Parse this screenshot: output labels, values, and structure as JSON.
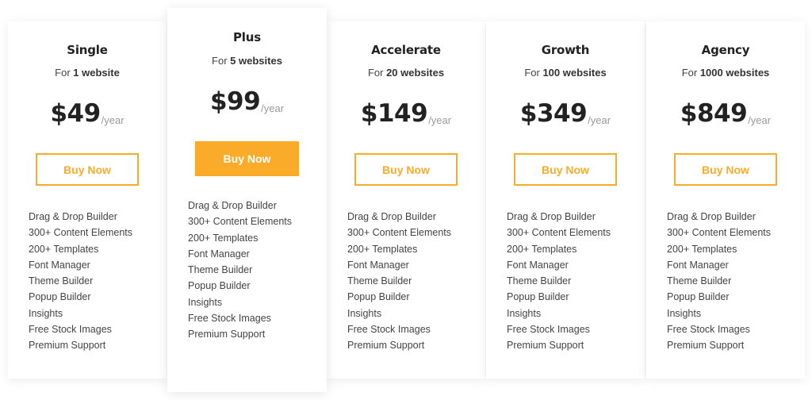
{
  "plans": [
    {
      "name": "Single",
      "sites_prefix": "For",
      "sites_count": "1 website",
      "price": "$49",
      "period": "/year",
      "button_label": "Buy Now",
      "featured": false,
      "features": [
        "Drag & Drop Builder",
        "300+ Content Elements",
        "200+ Templates",
        "Font Manager",
        "Theme Builder",
        "Popup Builder",
        "Insights",
        "Free Stock Images",
        "Premium Support"
      ]
    },
    {
      "name": "Plus",
      "sites_prefix": "For",
      "sites_count": "5 websites",
      "price": "$99",
      "period": "/year",
      "button_label": "Buy Now",
      "featured": true,
      "features": [
        "Drag & Drop Builder",
        "300+ Content Elements",
        "200+ Templates",
        "Font Manager",
        "Theme Builder",
        "Popup Builder",
        "Insights",
        "Free Stock Images",
        "Premium Support"
      ]
    },
    {
      "name": "Accelerate",
      "sites_prefix": "For",
      "sites_count": "20 websites",
      "price": "$149",
      "period": "/year",
      "button_label": "Buy Now",
      "featured": false,
      "features": [
        "Drag & Drop Builder",
        "300+ Content Elements",
        "200+ Templates",
        "Font Manager",
        "Theme Builder",
        "Popup Builder",
        "Insights",
        "Free Stock Images",
        "Premium Support"
      ]
    },
    {
      "name": "Growth",
      "sites_prefix": "For",
      "sites_count": "100 websites",
      "price": "$349",
      "period": "/year",
      "button_label": "Buy Now",
      "featured": false,
      "features": [
        "Drag & Drop Builder",
        "300+ Content Elements",
        "200+ Templates",
        "Font Manager",
        "Theme Builder",
        "Popup Builder",
        "Insights",
        "Free Stock Images",
        "Premium Support"
      ]
    },
    {
      "name": "Agency",
      "sites_prefix": "For",
      "sites_count": "1000 websites",
      "price": "$849",
      "period": "/year",
      "button_label": "Buy Now",
      "featured": false,
      "features": [
        "Drag & Drop Builder",
        "300+ Content Elements",
        "200+ Templates",
        "Font Manager",
        "Theme Builder",
        "Popup Builder",
        "Insights",
        "Free Stock Images",
        "Premium Support"
      ]
    }
  ],
  "colors": {
    "accent": "#fbab2a",
    "heading": "#222222",
    "text": "#444444",
    "muted": "#999999"
  }
}
